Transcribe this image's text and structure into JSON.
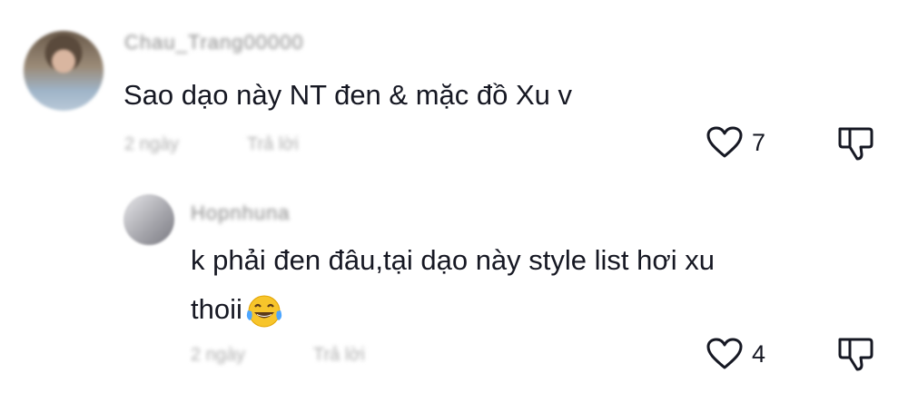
{
  "comments": [
    {
      "username": "Chau_Trang00000",
      "text": "Sao dạo này NT đen & mặc đồ Xu v",
      "time": "2 ngày",
      "reply_label": "Trả lời",
      "likes": "7",
      "icons": {
        "like": "heart-outline-icon",
        "dislike": "thumbs-down-icon"
      }
    },
    {
      "username": "Hopnhuna",
      "text_line1": "k phải đen đâu,tại dạo này style list hơi xu",
      "text_line2": "thoii",
      "emoji": "tears-of-joy-emoji",
      "time": "2 ngày",
      "reply_label": "Trả lời",
      "likes": "4",
      "icons": {
        "like": "heart-outline-icon",
        "dislike": "thumbs-down-icon"
      }
    }
  ],
  "colors": {
    "text": "#161823",
    "muted": "#8a8a8a",
    "background": "#ffffff"
  }
}
